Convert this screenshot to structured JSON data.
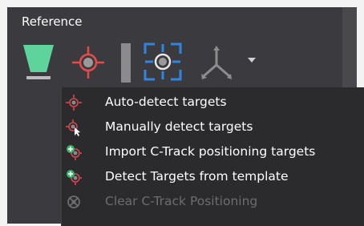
{
  "ribbon": {
    "title": "Reference"
  },
  "toolbar": {
    "tools": [
      {
        "name": "funnel-icon",
        "color": "#5fd39c"
      },
      {
        "name": "target-icon",
        "color": "#e84a4a"
      },
      {
        "name": "divider"
      },
      {
        "name": "detect-targets-icon",
        "color": "#2f86e0"
      },
      {
        "name": "axes-icon"
      }
    ]
  },
  "menu": {
    "items": [
      {
        "label": "Auto-detect targets",
        "icon": "crosshair-icon",
        "enabled": true
      },
      {
        "label": "Manually detect targets",
        "icon": "crosshair-cursor-icon",
        "enabled": true
      },
      {
        "label": "Import C-Track positioning targets",
        "icon": "crosshair-add-icon",
        "enabled": true
      },
      {
        "label": "Detect Targets from template",
        "icon": "crosshair-template-icon",
        "enabled": true
      },
      {
        "label": "Clear C-Track Positioning",
        "icon": "clear-icon",
        "enabled": false
      }
    ]
  }
}
